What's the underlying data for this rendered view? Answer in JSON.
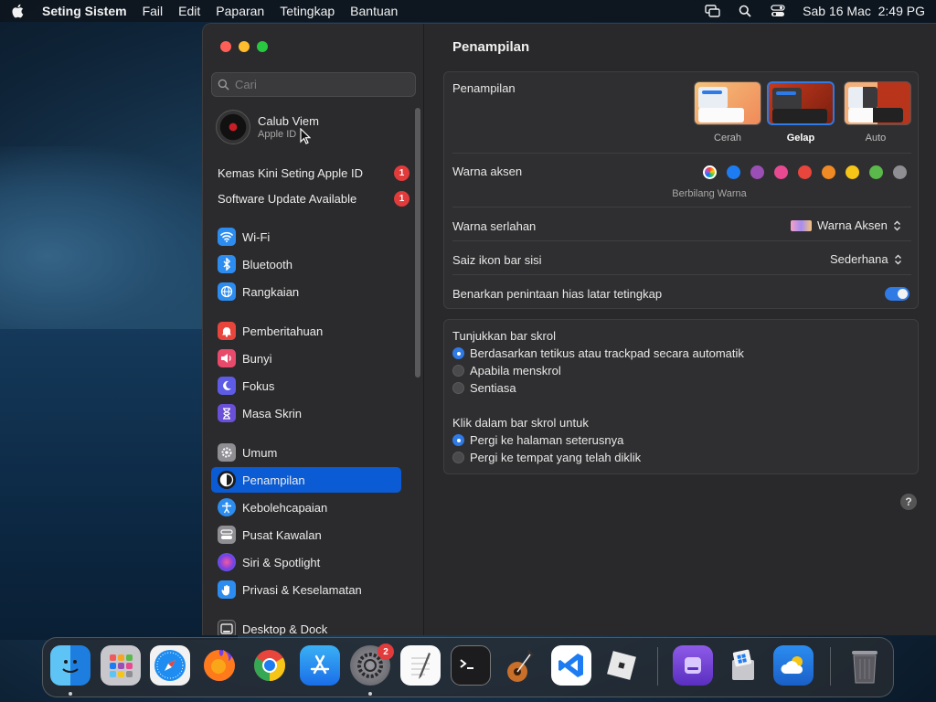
{
  "menubar": {
    "app_name": "Seting Sistem",
    "menus": [
      "Fail",
      "Edit",
      "Paparan",
      "Tetingkap",
      "Bantuan"
    ],
    "datetime": "Sab 16 Mac  2:49 PG"
  },
  "sidebar": {
    "search_placeholder": "Cari",
    "profile": {
      "name": "Calub Viem",
      "subtitle": "Apple ID"
    },
    "alerts": [
      {
        "label": "Kemas Kini Seting Apple ID",
        "badge": "1"
      },
      {
        "label": "Software Update Available",
        "badge": "1"
      }
    ],
    "items": [
      {
        "label": "Wi-Fi",
        "icon": "wifi-icon",
        "color": "#2d8cf0"
      },
      {
        "label": "Bluetooth",
        "icon": "bluetooth-icon",
        "color": "#2d8cf0"
      },
      {
        "label": "Rangkaian",
        "icon": "globe-icon",
        "color": "#2d8cf0"
      },
      {
        "label": "Pemberitahuan",
        "icon": "bell-icon",
        "color": "#e8453c"
      },
      {
        "label": "Bunyi",
        "icon": "speaker-icon",
        "color": "#e84a6b"
      },
      {
        "label": "Fokus",
        "icon": "moon-icon",
        "color": "#5e5ce6"
      },
      {
        "label": "Masa Skrin",
        "icon": "hourglass-icon",
        "color": "#6a4fd8"
      },
      {
        "label": "Umum",
        "icon": "gear-icon",
        "color": "#8e8e93"
      },
      {
        "label": "Penampilan",
        "icon": "appearance-icon",
        "color": "#1c1c1e"
      },
      {
        "label": "Kebolehcapaian",
        "icon": "accessibility-icon",
        "color": "#2d8cf0"
      },
      {
        "label": "Pusat Kawalan",
        "icon": "control-center-icon",
        "color": "#8e8e93"
      },
      {
        "label": "Siri & Spotlight",
        "icon": "siri-icon",
        "color": "#9b4de0"
      },
      {
        "label": "Privasi & Keselamatan",
        "icon": "hand-icon",
        "color": "#2d8cf0"
      },
      {
        "label": "Desktop & Dock",
        "icon": "dock-icon",
        "color": "#3a3a3c"
      }
    ],
    "active": "Penampilan"
  },
  "content": {
    "title": "Penampilan",
    "appearance": {
      "label": "Penampilan",
      "options": [
        "Cerah",
        "Gelap",
        "Auto"
      ],
      "selected": "Gelap"
    },
    "accent": {
      "label": "Warna aksen",
      "caption": "Berbilang Warna",
      "colors": [
        "#ff7a1a",
        "#1e7cf2",
        "#9b4fb5",
        "#e84a92",
        "#e8453c",
        "#f08a24",
        "#f5c518",
        "#5bb84a",
        "#8e8e93"
      ]
    },
    "highlight": {
      "label": "Warna serlahan",
      "value": "Warna Aksen"
    },
    "sidebar_icon_size": {
      "label": "Saiz ikon bar sisi",
      "value": "Sederhana"
    },
    "tinting": {
      "label": "Benarkan penintaan hias latar tetingkap",
      "on": true
    },
    "show_scrollbars": {
      "label": "Tunjukkan bar skrol",
      "options": [
        "Berdasarkan tetikus atau trackpad secara automatik",
        "Apabila menskrol",
        "Sentiasa"
      ],
      "selected": 0
    },
    "click_scrollbar": {
      "label": "Klik dalam bar skrol untuk",
      "options": [
        "Pergi ke halaman seterusnya",
        "Pergi ke tempat yang telah diklik"
      ],
      "selected": 0
    },
    "help": "?"
  },
  "dock": {
    "apps": [
      "finder-icon",
      "launchpad-icon",
      "safari-icon",
      "firefox-icon",
      "chrome-icon",
      "app-store-icon",
      "system-settings-icon",
      "textedit-icon",
      "terminal-icon",
      "garageband-icon",
      "vscode-icon",
      "roblox-icon",
      "disk-icon",
      "bootcamp-icon",
      "weather-icon",
      "trash-icon"
    ],
    "settings_badge": "2"
  }
}
